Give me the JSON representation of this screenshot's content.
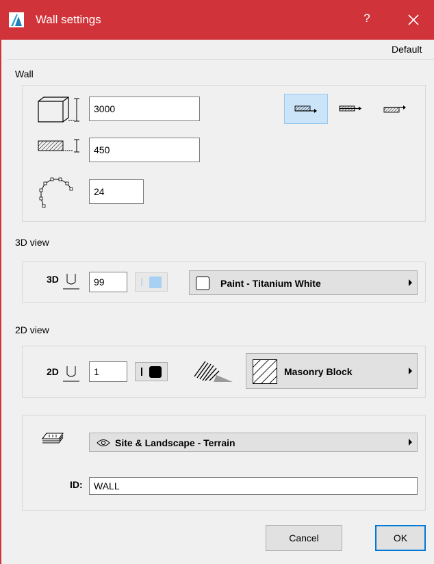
{
  "window": {
    "title": "Wall settings",
    "help_label": "?",
    "default_label": "Default",
    "accent": "#d1333a"
  },
  "wall": {
    "section_title": "Wall",
    "height_value": "3000",
    "thickness_value": "450",
    "segments_value": "24",
    "icons": {
      "height": "wall-height-icon",
      "thickness": "wall-thickness-icon",
      "segments": "curved-wall-segments-icon"
    },
    "location_options": [
      "reference-line-outside-icon",
      "reference-line-center-icon",
      "reference-line-inside-icon"
    ],
    "selected_location": 0
  },
  "view3d": {
    "section_title": "3D view",
    "pen_label": "3D",
    "pen_value": "99",
    "pen_color": "#a8d0f5",
    "surface_label": "Paint - Titanium White",
    "surface_swatch": "#ffffff"
  },
  "view2d": {
    "section_title": "2D view",
    "pen_label": "2D",
    "pen_value": "1",
    "pen_color": "#000000",
    "fill_label": "Masonry Block"
  },
  "layer": {
    "label": "Site & Landscape - Terrain",
    "id_label": "ID:",
    "id_value": "WALL"
  },
  "buttons": {
    "cancel": "Cancel",
    "ok": "OK"
  }
}
